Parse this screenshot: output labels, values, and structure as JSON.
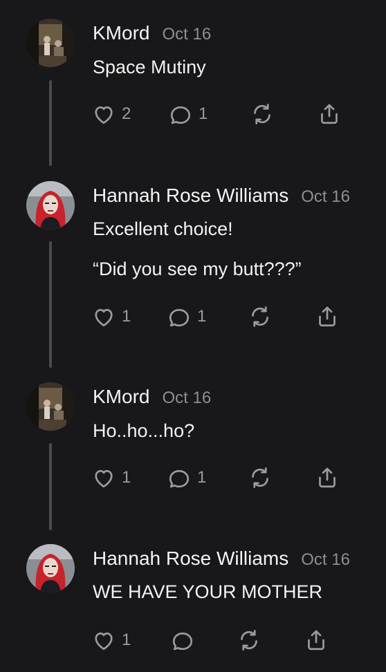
{
  "posts": [
    {
      "author": "KMord",
      "date": "Oct 16",
      "lines": [
        "Space Mutiny"
      ],
      "likes": "2",
      "replies": "1",
      "avatar": "kmord"
    },
    {
      "author": "Hannah Rose Williams",
      "date": "Oct 16",
      "lines": [
        "Excellent choice!",
        "“Did you see my butt???”"
      ],
      "likes": "1",
      "replies": "1",
      "avatar": "hannah"
    },
    {
      "author": "KMord",
      "date": "Oct 16",
      "lines": [
        "Ho..ho...ho?"
      ],
      "likes": "1",
      "replies": "1",
      "avatar": "kmord"
    },
    {
      "author": "Hannah Rose Williams",
      "date": "Oct 16",
      "lines": [
        "WE HAVE YOUR MOTHER"
      ],
      "likes": "1",
      "replies": "",
      "avatar": "hannah"
    }
  ],
  "icons": {
    "like": "heart-icon",
    "reply": "speech-bubble-icon",
    "repost": "repost-arrows-icon",
    "share": "share-icon"
  },
  "colors": {
    "background": "#18181b",
    "text": "#f2f2f2",
    "muted": "#8e8e93",
    "thread_line": "#4a4a4f"
  }
}
